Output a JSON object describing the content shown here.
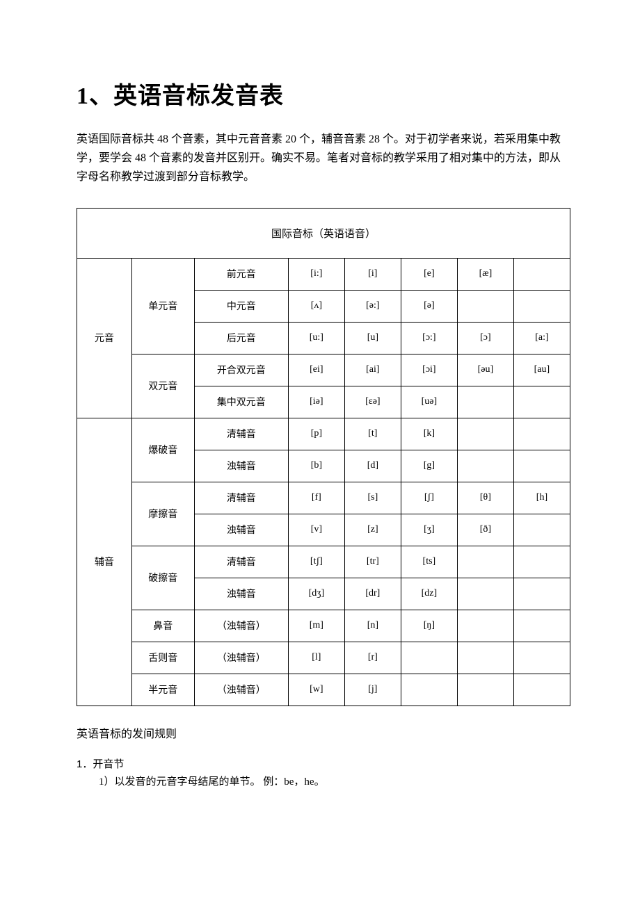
{
  "title": "1、英语音标发音表",
  "intro": "英语国际音标共 48 个音素，其中元音音素 20 个，辅音音素 28 个。对于初学者来说，若采用集中教学，要学会 48 个音素的发音并区别开。确实不易。笔者对音标的教学采用了相对集中的方法，即从字母名称教学过渡到部分音标教学。",
  "table": {
    "caption": "国际音标（英语语音）",
    "groups": [
      {
        "name": "元音",
        "subgroups": [
          {
            "name": "单元音",
            "rows": [
              {
                "label": "前元音",
                "cells": [
                  "[i:]",
                  "[i]",
                  "[e]",
                  "[æ]",
                  ""
                ]
              },
              {
                "label": "中元音",
                "cells": [
                  "[ʌ]",
                  "[ə:]",
                  "[ə]",
                  "",
                  ""
                ]
              },
              {
                "label": "后元音",
                "cells": [
                  "[u:]",
                  "[u]",
                  "[ɔ:]",
                  "[ɔ]",
                  "[a:]"
                ]
              }
            ]
          },
          {
            "name": "双元音",
            "rows": [
              {
                "label": "开合双元音",
                "cells": [
                  "[ei]",
                  "[ai]",
                  "[ɔi]",
                  "[əu]",
                  "[au]"
                ]
              },
              {
                "label": "集中双元音",
                "cells": [
                  "[iə]",
                  "[ɛə]",
                  "[uə]",
                  "",
                  ""
                ]
              }
            ]
          }
        ]
      },
      {
        "name": "辅音",
        "subgroups": [
          {
            "name": "爆破音",
            "rows": [
              {
                "label": "清辅音",
                "cells": [
                  "[p]",
                  "[t]",
                  "[k]",
                  "",
                  ""
                ]
              },
              {
                "label": "浊辅音",
                "cells": [
                  "[b]",
                  "[d]",
                  "[g]",
                  "",
                  ""
                ]
              }
            ]
          },
          {
            "name": "摩擦音",
            "rows": [
              {
                "label": "清辅音",
                "cells": [
                  "[f]",
                  "[s]",
                  "[ʃ]",
                  "[θ]",
                  "[h]"
                ]
              },
              {
                "label": "浊辅音",
                "cells": [
                  "[v]",
                  "[z]",
                  "[ʒ]",
                  "[ð]",
                  ""
                ]
              }
            ]
          },
          {
            "name": "破擦音",
            "rows": [
              {
                "label": "清辅音",
                "cells": [
                  "[tʃ]",
                  "[tr]",
                  "[ts]",
                  "",
                  ""
                ]
              },
              {
                "label": "浊辅音",
                "cells": [
                  "[dʒ]",
                  "[dr]",
                  "[dz]",
                  "",
                  ""
                ]
              }
            ]
          },
          {
            "name": "鼻音",
            "rows": [
              {
                "label": "（浊辅音）",
                "cells": [
                  "[m]",
                  "[n]",
                  "[ŋ]",
                  "",
                  ""
                ]
              }
            ]
          },
          {
            "name": "舌则音",
            "rows": [
              {
                "label": "（浊辅音）",
                "cells": [
                  "[l]",
                  "[r]",
                  "",
                  "",
                  ""
                ]
              }
            ]
          },
          {
            "name": "半元音",
            "rows": [
              {
                "label": "（浊辅音）",
                "cells": [
                  "[w]",
                  "[j]",
                  "",
                  "",
                  ""
                ]
              }
            ]
          }
        ]
      }
    ]
  },
  "rules": {
    "heading": "英语音标的发间规则",
    "item1_num": "1．开音节",
    "item1_sub": "1）以发音的元音字母结尾的单节。 例：be，he。"
  }
}
